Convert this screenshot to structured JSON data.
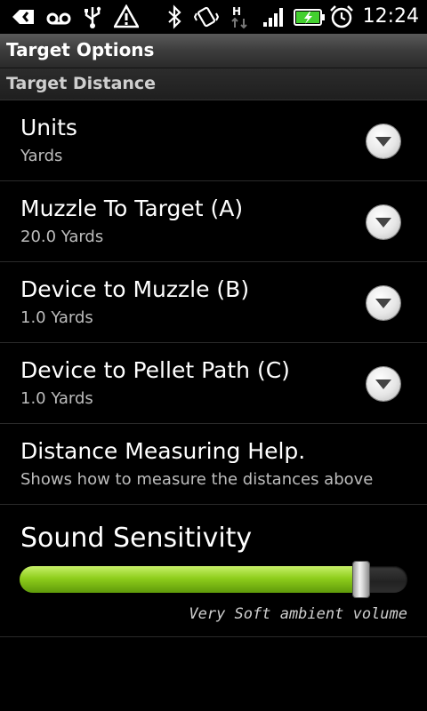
{
  "status_bar": {
    "icons": [
      "back-arrow-icon",
      "voicemail-icon",
      "usb-icon",
      "warning-icon",
      "bluetooth-icon",
      "vibrate-icon",
      "hspa-data-icon",
      "signal-icon",
      "battery-charging-icon",
      "alarm-icon"
    ],
    "time": "12:24",
    "battery_color": "#43d02f"
  },
  "title_bar": {
    "title": "Target Options"
  },
  "section": {
    "title": "Target Distance"
  },
  "preferences": [
    {
      "title": "Units",
      "summary": "Yards",
      "has_dropdown": true
    },
    {
      "title": "Muzzle To Target (A)",
      "summary": "20.0 Yards",
      "has_dropdown": true
    },
    {
      "title": "Device to Muzzle (B)",
      "summary": "1.0 Yards",
      "has_dropdown": true
    },
    {
      "title": "Device to Pellet Path (C)",
      "summary": "1.0 Yards",
      "has_dropdown": true
    },
    {
      "title": "Distance Measuring Help.",
      "summary": "Shows how to measure the distances above",
      "has_dropdown": false
    }
  ],
  "sound": {
    "title": "Sound Sensitivity",
    "level": 0.88,
    "caption": "Very Soft ambient volume",
    "fill_color": "#8fce1c"
  }
}
